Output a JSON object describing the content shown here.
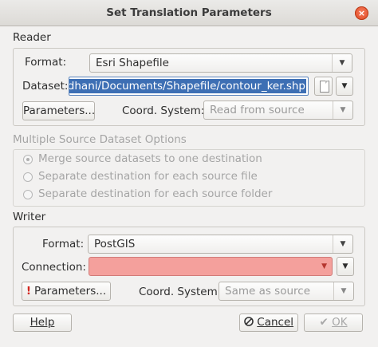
{
  "window": {
    "title": "Set Translation Parameters",
    "close_glyph": "×"
  },
  "reader": {
    "heading": "Reader",
    "format_label": "Format:",
    "format_value": "Esri Shapefile",
    "dataset_label": "Dataset:",
    "dataset_value": "e/dhani/Documents/Shapefile/contour_ker.shp",
    "parameters_label": "Parameters...",
    "coord_label": "Coord. System:",
    "coord_value": "Read from source"
  },
  "multi_source": {
    "heading": "Multiple Source Dataset Options",
    "options": [
      {
        "label": "Merge source datasets to one destination",
        "checked": true
      },
      {
        "label": "Separate destination for each source file",
        "checked": false
      },
      {
        "label": "Separate destination for each source folder",
        "checked": false
      }
    ]
  },
  "writer": {
    "heading": "Writer",
    "format_label": "Format:",
    "format_value": "PostGIS",
    "connection_label": "Connection:",
    "connection_value": "",
    "parameters_label": "Parameters...",
    "coord_label": "Coord. System:",
    "coord_value": "Same as source"
  },
  "buttons": {
    "help": "Help",
    "cancel": "Cancel",
    "ok": "OK"
  },
  "icons": {
    "close": "close-icon",
    "dropdown": "chevron-down-icon",
    "file": "file-browse-icon",
    "warning": "warning-icon",
    "cancel": "no-entry-icon",
    "ok": "checkmark-icon"
  },
  "colors": {
    "selection": "#3d6fb4",
    "error_field": "#f4a09c",
    "warning": "#d3261e",
    "close_button": "#e0461f"
  }
}
